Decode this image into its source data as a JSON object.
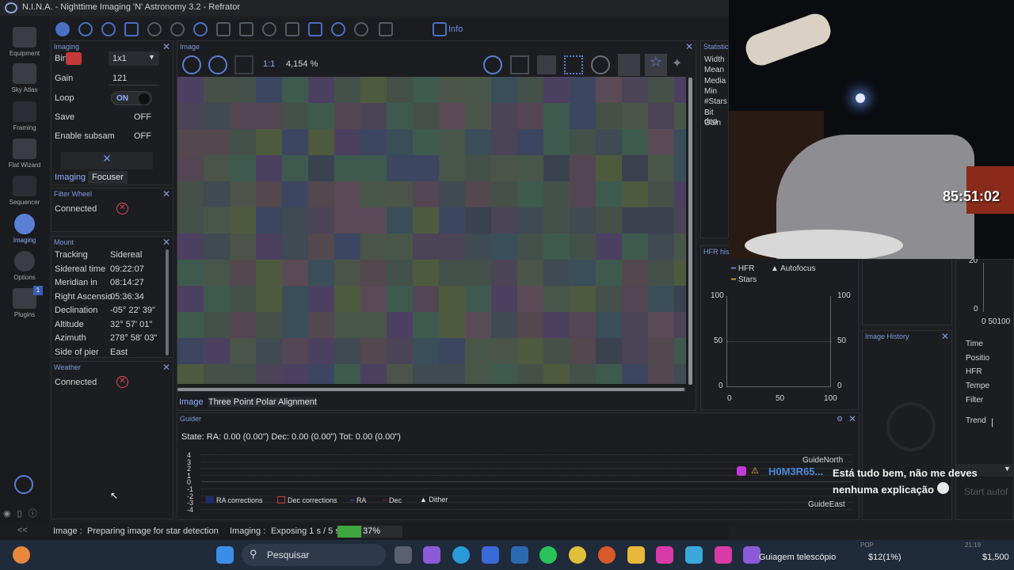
{
  "window": {
    "title": "N.I.N.A. - Nighttime Imaging 'N' Astronomy 3.2  -  Refrator"
  },
  "sidebar": {
    "items": [
      {
        "label": "Equipment"
      },
      {
        "label": "Sky Atlas"
      },
      {
        "label": "Framing"
      },
      {
        "label": "Flat Wizard"
      },
      {
        "label": "Sequencer"
      },
      {
        "label": "Imaging"
      },
      {
        "label": "Options"
      },
      {
        "label": "Plugins"
      }
    ],
    "plugins_badge": "1",
    "collapse": "<<"
  },
  "toolbar": {
    "info_label": "Info"
  },
  "imaging_panel": {
    "title": "Imaging",
    "bin_label": "Bin",
    "bin_value": "1x1",
    "gain_label": "Gain",
    "gain_value": "121",
    "loop_label": "Loop",
    "loop_value": "ON",
    "save_label": "Save",
    "save_value": "OFF",
    "subsample_label": "Enable subsam",
    "subsample_value": "OFF",
    "tabs": [
      "Imaging",
      "Focuser"
    ]
  },
  "filter_wheel": {
    "title": "Filter Wheel",
    "connected_label": "Connected"
  },
  "mount": {
    "title": "Mount",
    "rows": [
      {
        "label": "Tracking",
        "value": "Sidereal"
      },
      {
        "label": "Sidereal time",
        "value": "09:22:07"
      },
      {
        "label": "Meridian in",
        "value": "08:14:27"
      },
      {
        "label": "Right Ascensio",
        "value": "05:36:34"
      },
      {
        "label": "Declination",
        "value": "-05° 22' 39\""
      },
      {
        "label": "Altitude",
        "value": "32° 57' 01\""
      },
      {
        "label": "Azimuth",
        "value": "278° 58' 03\""
      },
      {
        "label": "Side of pier",
        "value": "East"
      }
    ]
  },
  "weather": {
    "title": "Weather",
    "connected_label": "Connected"
  },
  "image_panel": {
    "title": "Image",
    "zoom_label": "1:1",
    "zoom_value": "4,154 %",
    "tabs": [
      "Image",
      "Three Point Polar Alignment"
    ]
  },
  "statistics": {
    "title": "Statistics",
    "rows": [
      "Width",
      "Mean",
      "Media",
      "Min",
      "#Stars",
      "Bit dep",
      "Gain"
    ]
  },
  "hfr_history": {
    "title": "HFR histo",
    "legend": [
      "HFR",
      "Autofocus",
      "Stars"
    ],
    "y_ticks": [
      "100",
      "50",
      "0"
    ],
    "y2_ticks": [
      "100",
      "50",
      "0"
    ],
    "x_ticks": [
      "0",
      "50",
      "100"
    ]
  },
  "image_history": {
    "title": "Image History"
  },
  "right_info": {
    "rows": [
      "Time",
      "Positio",
      "HFR",
      "Tempe",
      "Filter",
      "Trend"
    ],
    "y_ticks": [
      "20",
      "0"
    ],
    "x_ticks": "0 50100",
    "start_button": "Start autof"
  },
  "guider": {
    "title": "Guider",
    "state": "State:   RA: 0.00 (0.00\")  Dec: 0.00 (0.00\")  Tot: 0.00 (0.00\")",
    "y_ticks": [
      "4",
      "3",
      "2",
      "1",
      "0",
      "-1",
      "-2",
      "-3",
      "-4"
    ],
    "north_label": "GuideNorth",
    "east_label": "GuideEast",
    "legend": [
      "RA corrections",
      "Dec corrections",
      "RA",
      "Dec",
      "Dither"
    ]
  },
  "status": {
    "image_label": "Image :",
    "image_status": "Preparing image for star detection",
    "imaging_label": "Imaging :",
    "imaging_status": "Exposing 1 s / 5 s",
    "progress_fraction": 0.37,
    "progress_text": "37%"
  },
  "stream": {
    "timer": "85:51:02",
    "chat_user": "H0M3R65...",
    "chat_message": "Está tudo bem, não me deves nenhuma explicação"
  },
  "taskbar": {
    "search_placeholder": "Pesquisar",
    "active_app": "Guiagem telescópio",
    "stock_change": "$12(1%)",
    "stock_price": "$1,500",
    "bottom_clip": [
      "POP",
      "21:19"
    ]
  },
  "colors": {
    "accent": "#5a7fd4",
    "error": "#e24a5a",
    "progress": "#3fa540"
  }
}
